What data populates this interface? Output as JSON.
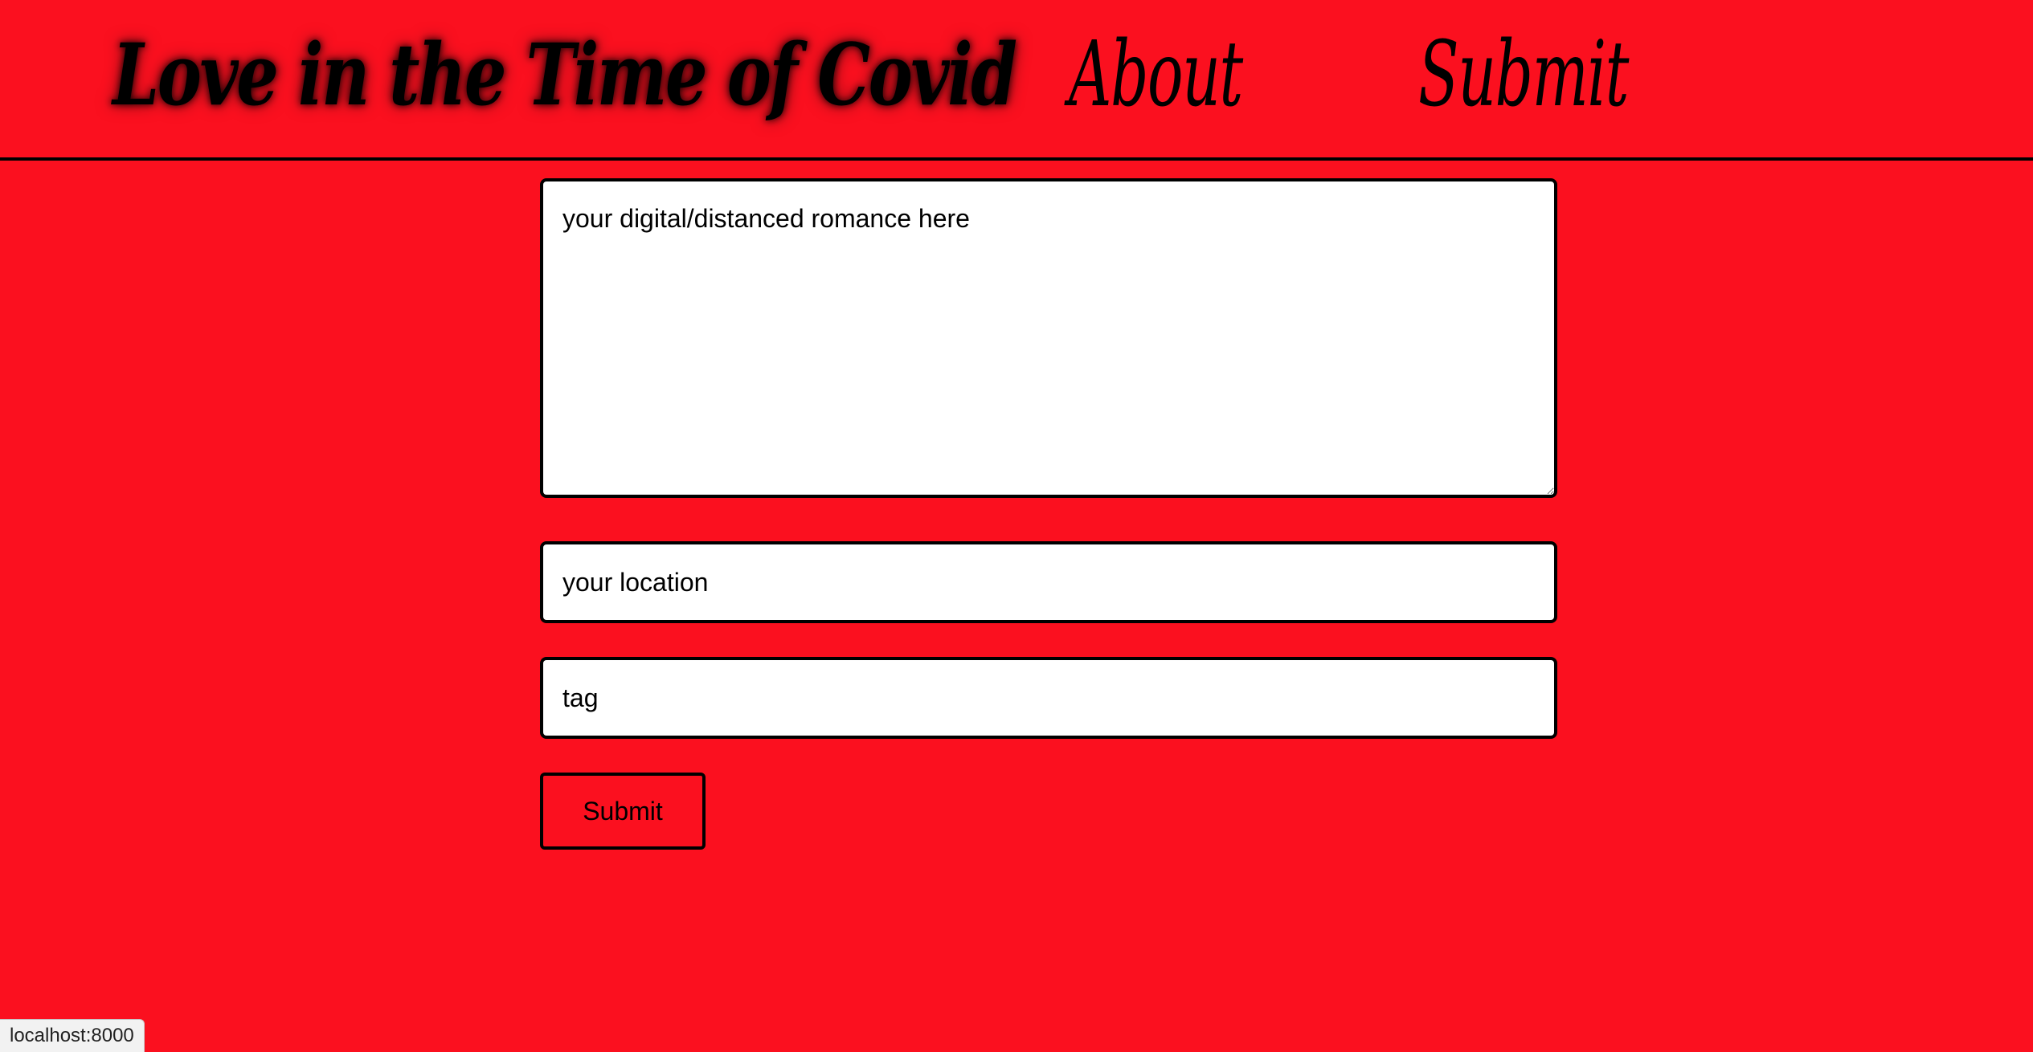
{
  "header": {
    "brand": "Love in the Time of Covid",
    "nav": {
      "about": "About",
      "submit": "Submit"
    }
  },
  "form": {
    "story_placeholder": "your digital/distanced romance here",
    "location_placeholder": "your location",
    "tag_placeholder": "tag",
    "submit_label": "Submit"
  },
  "status_bar": {
    "url": "localhost:8000"
  },
  "colors": {
    "background": "#fb101f",
    "text": "#000000",
    "field_background": "#ffffff"
  }
}
